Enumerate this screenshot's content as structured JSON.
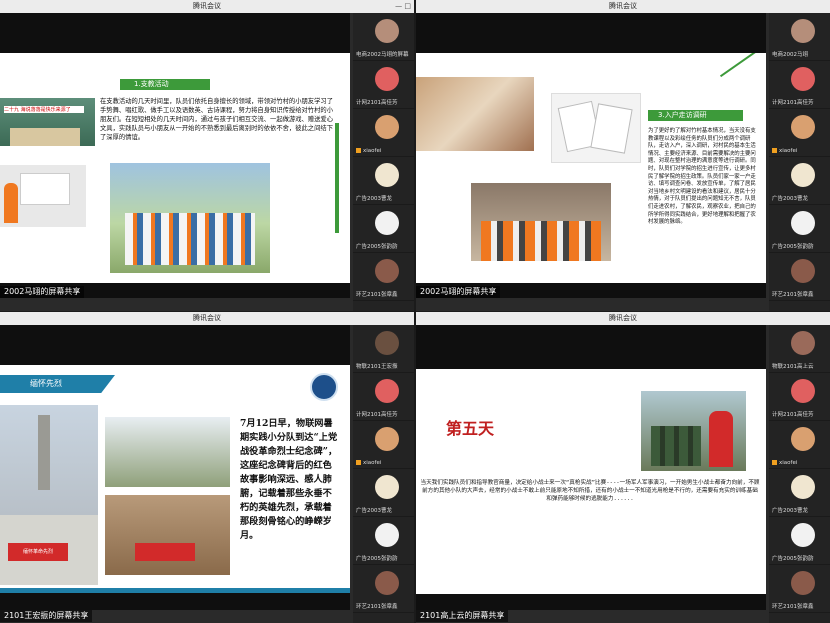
{
  "app_title": "腾讯会议",
  "panels": [
    {
      "share": "2002马翊的屏幕共享",
      "heading": "1.支教活动",
      "body": "在支教活动的几天时间里，队员们依托自身擅长的领域，带领对竹村的小朋友学习了手势舞、唱红歌、做手工以及语数英、古诗课程，努力将自身知识传授给对竹村的小朋友们。在短短相处的几天时间内，通过与孩子们相互交流、一起做游戏、赠送爱心文具，实践队员与小朋友从一开始的不熟悉到最后离别时的依依不舍，彼此之间结下了深厚的情谊。",
      "photo_sign": "二十九 海说落落是快乐来源了"
    },
    {
      "share": "2002马翊的屏幕共享",
      "heading": "3.入户走访调研",
      "body": "为了更好的了解对竹村基本情况，当天没有支教课程以及彩绘任务的队员们分成两个调研队，走访入户，深入调研，对村民的基本生活情况、主要经济来源、目前需要解决的主要问题、对现在整村治理的满意度等进行调研。同时，队员们对学院的招生进行宣传，让更多村民了解学院的招生政策。队员们家一家一户走访、填写调查问卷、发放宣传单，了解了居民对当地乡村文明建设的看法和建议，居民十分热情，对于队员们提出的问题知无不言，队员们走进农村，了解农民，观察农业，把自己的所学所得同实践结合，更好地理解和把握了农村发展的脉络。"
    },
    {
      "share": "2101王宏振的屏幕共享",
      "heading": "缅怀先烈",
      "body": "7月12日早，物联网暑期实践小分队到达“上党战役革命烈士纪念碑”，这座纪念碑背后的红色故事影响深远、感人肺腑，记载着那些永垂不朽的英雄先烈，承载着那段刻骨铭心的峥嵘岁月。",
      "banner": "缅怀革命先烈"
    },
    {
      "share": "2101高上云的屏幕共享",
      "heading": "第五天",
      "body": "当天我们实践队员们和指导教官商量，决定给小战士来一次“真枪实战”比赛----一场军人军事演习，一开始男生小战士都奋力向前，不顾前方的其他小队的大声去，经常的小战士不敢上前只能原地不知所措，还有的小战士一不知道光用枪是不行的，还需要有充实的训练基础和弹药能够时候的逃脱能力......"
    }
  ],
  "participants": [
    [
      "电商2002马翊的屏幕",
      "计网2101高佳芳",
      "xiaofei",
      "广告2003曹龙",
      "广告2005张韵韵",
      "环艺2101张章鑫"
    ],
    [
      "电商2002马翊",
      "计网2101高佳芳",
      "xiaofei",
      "广告2003曹龙",
      "广告2005张韵韵",
      "环艺2101张章鑫"
    ],
    [
      "物联2101王宏振",
      "计网2101高佳芳",
      "xiaofei",
      "广告2003曹龙",
      "广告2005张韵韵",
      "环艺2101张章鑫"
    ],
    [
      "物联2101高上云",
      "计网2101高佳芳",
      "xiaofei",
      "广告2003曹龙",
      "广告2005张韵韵",
      "环艺2101张章鑫"
    ]
  ],
  "window_controls": "— □"
}
